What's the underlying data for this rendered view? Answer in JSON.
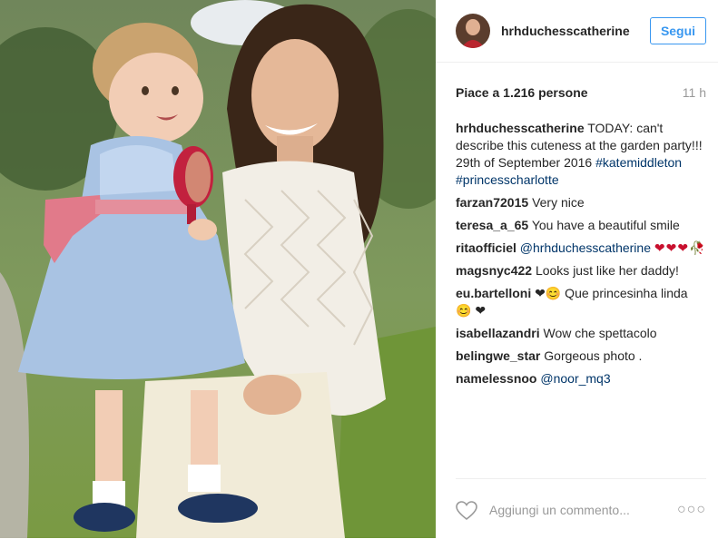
{
  "post": {
    "username": "hrhduchesscatherine",
    "follow_label": "Segui",
    "likes": "Piace a 1.216 persone",
    "time": "11 h",
    "caption": {
      "user": "hrhduchesscatherine",
      "text": " TODAY: can't describe this cuteness at the garden party!!! 29th of September 2016 ",
      "tag1": "#katemiddleton",
      "tag2": "#princesscharlotte"
    },
    "comments": [
      {
        "user": "farzan72015",
        "text": "Very nice"
      },
      {
        "user": "teresa_a_65",
        "text": "You have a beautiful smile"
      },
      {
        "user": "ritaofficiel",
        "mention": "@hrhduchesscatherine",
        "text": "❤❤❤🥀"
      },
      {
        "user": "magsnyc422",
        "text": "Looks just like her daddy!"
      },
      {
        "user": "eu.bartelloni",
        "text": "❤😊 Que princesinha linda 😊 ❤"
      },
      {
        "user": "isabellazandri",
        "text": "Wow che spettacolo"
      },
      {
        "user": "belingwe_star",
        "text": "Gorgeous photo ."
      },
      {
        "user": "namelessnoo",
        "mention": "@noor_mq3",
        "text": ""
      }
    ],
    "add_comment_placeholder": "Aggiungi un commento...",
    "more_icon": "more-icon"
  },
  "colors": {
    "link": "#003569",
    "accent": "#3897f0",
    "muted": "#999999"
  }
}
